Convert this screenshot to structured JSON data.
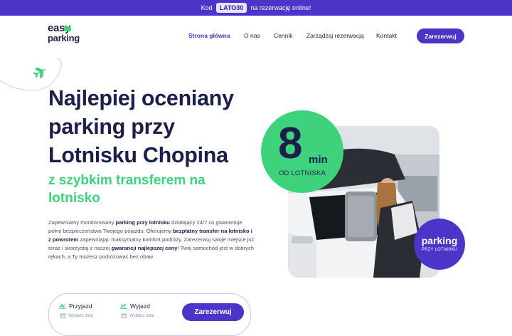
{
  "promo": {
    "prefix": "Kod",
    "code": "LATO30",
    "suffix": "na rezerwację online!"
  },
  "logo": {
    "line1": "easy",
    "line2": "parking"
  },
  "nav": {
    "items": [
      {
        "label": "Strona główna",
        "active": true
      },
      {
        "label": "O nas",
        "active": false
      },
      {
        "label": "Cennik",
        "active": false
      },
      {
        "label": "Zarządzaj rezerwacją",
        "active": false
      },
      {
        "label": "Kontakt",
        "active": false
      }
    ],
    "cta": "Zarezerwuj"
  },
  "hero": {
    "title": "Najlepiej oceniany parking przy Lotnisku Chopina",
    "subtitle": "z szybkim transferem na lotnisko",
    "desc": {
      "t1": "Zapewniamy monitorowany ",
      "b1": "parking przy lotnisku",
      "t2": " działający 24/7 co gwarantuje pełne bezpieczeństwo Twojego pojazdu. Oferujemy ",
      "b2": "bezpłatny transfer na lotnisko i z powrotem",
      "t3": " zapewniając maksymalny komfort podróży. Zarezerwuj swoje miejsce już teraz i skorzystaj z naszej ",
      "b3": "gwarancji najlepszej ceny",
      "t4": "! Twój samochód jest w dobrych rękach, a Ty możesz podróżować bez obaw."
    }
  },
  "booking": {
    "arrival": {
      "label": "Przyjazd",
      "placeholder": "Wybierz datę"
    },
    "departure": {
      "label": "Wyjazd",
      "placeholder": "Wybierz datę"
    },
    "button": "Zarezerwuj"
  },
  "badge_time": {
    "number": "8",
    "unit": "min",
    "caption": "OD LOTNISKA"
  },
  "badge_parking": {
    "title": "parking",
    "caption": "PRZY LOTNISKU"
  },
  "colors": {
    "primary": "#4a35c8",
    "accent": "#3fd27d",
    "text": "#1c1f4a"
  },
  "icons": [
    "plane-icon",
    "plane-takeoff-icon",
    "plane-landing-icon",
    "calendar-icon",
    "car-icon"
  ]
}
